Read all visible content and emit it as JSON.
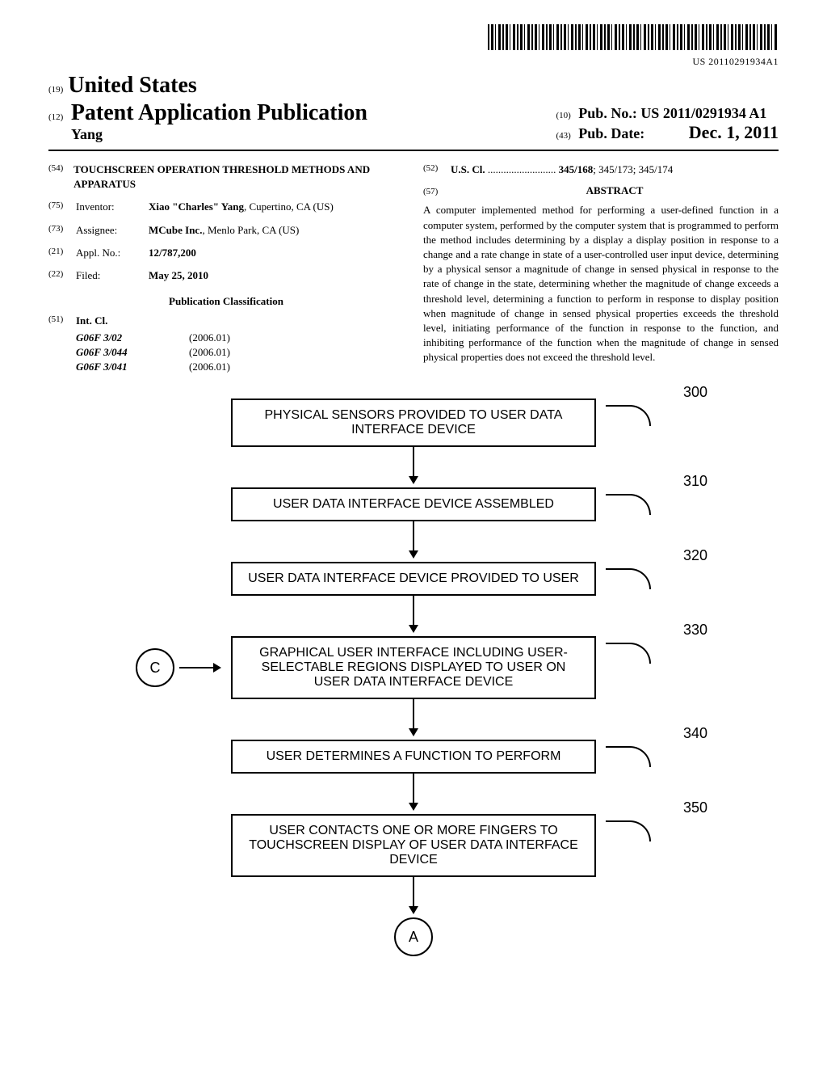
{
  "barcode_text": "US 20110291934A1",
  "country_code": "(19)",
  "country": "United States",
  "doc_type_code": "(12)",
  "doc_type": "Patent Application Publication",
  "inventor_short": "Yang",
  "pub_no_code": "(10)",
  "pub_no_label": "Pub. No.:",
  "pub_no_value": "US 2011/0291934 A1",
  "pub_date_code": "(43)",
  "pub_date_label": "Pub. Date:",
  "pub_date_value": "Dec. 1, 2011",
  "title_code": "(54)",
  "title": "TOUCHSCREEN OPERATION THRESHOLD METHODS AND APPARATUS",
  "inventor_code": "(75)",
  "inventor_label": "Inventor:",
  "inventor_value": "Xiao \"Charles\" Yang",
  "inventor_loc": ", Cupertino, CA (US)",
  "assignee_code": "(73)",
  "assignee_label": "Assignee:",
  "assignee_value": "MCube Inc.",
  "assignee_loc": ", Menlo Park, CA (US)",
  "appl_code": "(21)",
  "appl_label": "Appl. No.:",
  "appl_value": "12/787,200",
  "filed_code": "(22)",
  "filed_label": "Filed:",
  "filed_value": "May 25, 2010",
  "pubclass_heading": "Publication Classification",
  "intcl_code": "(51)",
  "intcl_label": "Int. Cl.",
  "intcl": [
    {
      "code": "G06F 3/02",
      "ver": "(2006.01)"
    },
    {
      "code": "G06F 3/044",
      "ver": "(2006.01)"
    },
    {
      "code": "G06F 3/041",
      "ver": "(2006.01)"
    }
  ],
  "uscl_code": "(52)",
  "uscl_label": "U.S. Cl.",
  "uscl_dots": " .......................... ",
  "uscl_bold": "345/168",
  "uscl_rest": "; 345/173; 345/174",
  "abstract_code": "(57)",
  "abstract_heading": "ABSTRACT",
  "abstract_text": "A computer implemented method for performing a user-defined function in a computer system, performed by the computer system that is programmed to perform the method includes determining by a display a display position in response to a change and a rate change in state of a user-controlled user input device, determining by a physical sensor a magnitude of change in sensed physical in response to the rate of change in the state, determining whether the magnitude of change exceeds a threshold level, determining a function to perform in response to display position when magnitude of change in sensed physical properties exceeds the threshold level, initiating performance of the function in response to the function, and inhibiting performance of the function when the magnitude of change in sensed physical properties does not exceed the threshold level.",
  "flow": {
    "steps": [
      {
        "ref": "300",
        "text": "PHYSICAL SENSORS PROVIDED TO USER DATA INTERFACE DEVICE"
      },
      {
        "ref": "310",
        "text": "USER DATA INTERFACE DEVICE ASSEMBLED"
      },
      {
        "ref": "320",
        "text": "USER DATA INTERFACE DEVICE PROVIDED TO USER"
      },
      {
        "ref": "330",
        "text": "GRAPHICAL USER INTERFACE INCLUDING USER-SELECTABLE REGIONS DISPLAYED TO USER ON USER DATA INTERFACE DEVICE",
        "side": "C"
      },
      {
        "ref": "340",
        "text": "USER DETERMINES A FUNCTION TO PERFORM"
      },
      {
        "ref": "350",
        "text": "USER CONTACTS ONE OR MORE FINGERS TO TOUCHSCREEN DISPLAY OF USER DATA INTERFACE DEVICE"
      }
    ],
    "end": "A"
  }
}
